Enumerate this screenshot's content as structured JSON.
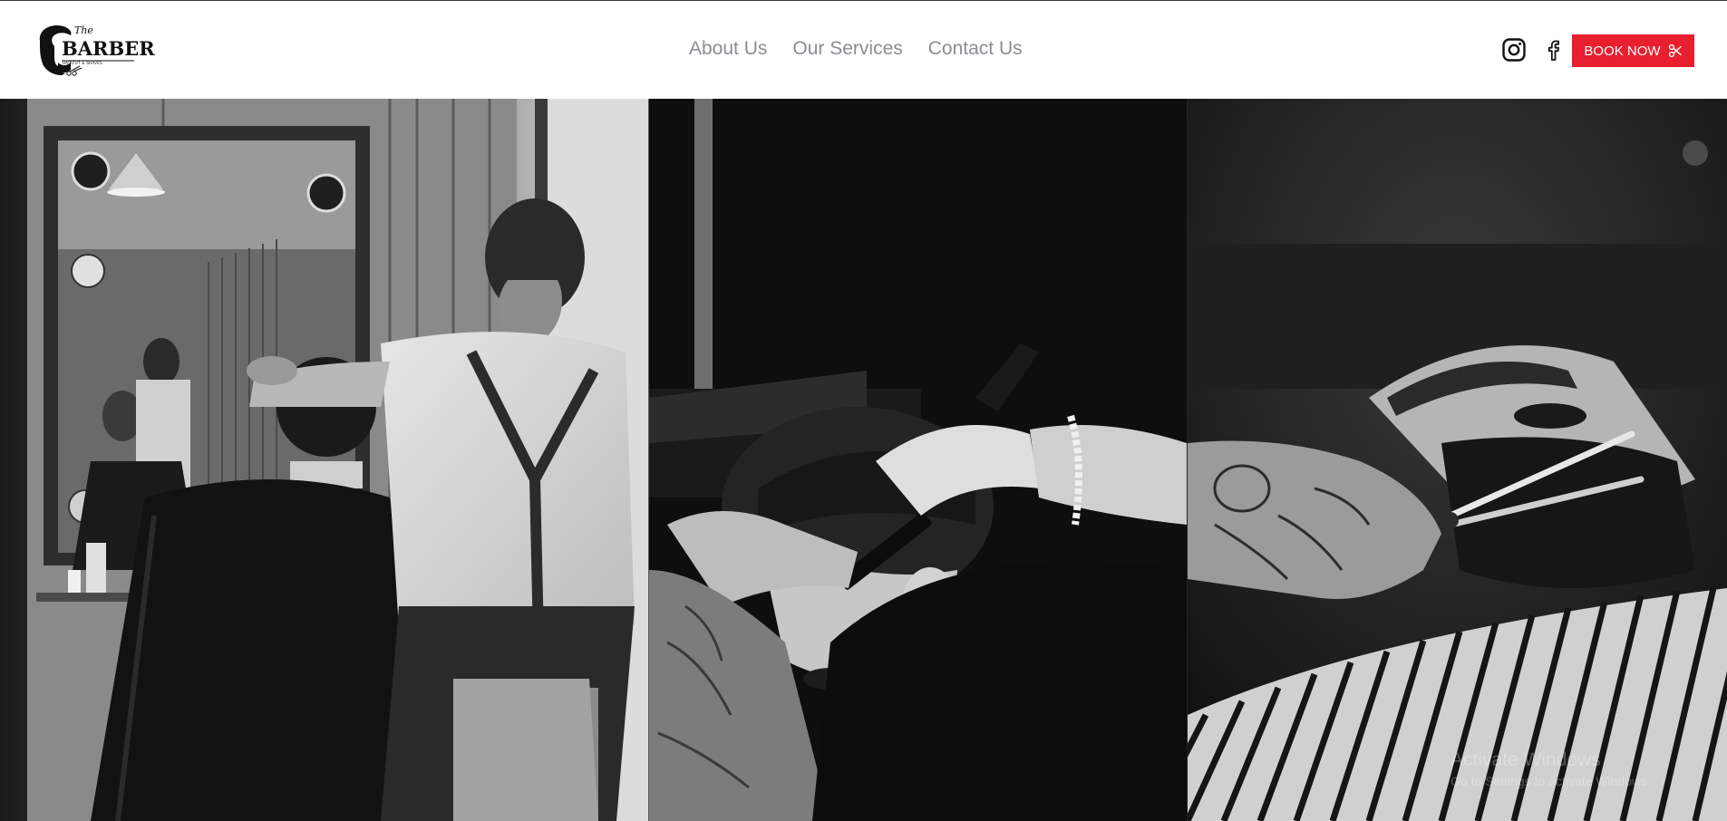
{
  "header": {
    "logo": {
      "the": "The",
      "name": "BARBER",
      "tagline": "HAIRCUT & SHAVES"
    },
    "nav": [
      {
        "label": "About Us"
      },
      {
        "label": "Our Services"
      },
      {
        "label": "Contact Us"
      }
    ],
    "social": {
      "instagram_icon": "instagram-icon",
      "facebook_icon": "facebook-icon"
    },
    "book_button": {
      "label": "BOOK NOW",
      "icon": "scissors-icon"
    }
  },
  "gallery": {
    "images": [
      {
        "name": "barber-cutting-hair-mirror"
      },
      {
        "name": "barber-straight-razor-neck"
      },
      {
        "name": "barber-trimming-beard-scissors"
      }
    ]
  },
  "watermark": {
    "line1": "Activate Windows",
    "line2": "Go to Settings to activate Windows."
  },
  "colors": {
    "accent": "#e81f2e",
    "nav_text": "#8d8d93",
    "background": "#ffffff"
  }
}
